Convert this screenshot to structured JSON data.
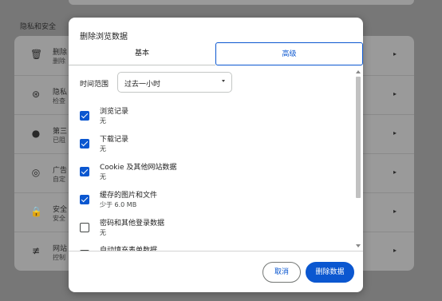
{
  "background": {
    "section_title": "隐私和安全",
    "rows": [
      {
        "icon": "trash-icon",
        "glyph": "🗑",
        "title": "删除",
        "subtitle": "删除"
      },
      {
        "icon": "safety-check-icon",
        "glyph": "⊛",
        "title": "隐私",
        "subtitle": "检查"
      },
      {
        "icon": "cookie-icon",
        "glyph": "●",
        "title": "第三",
        "subtitle": "已阻"
      },
      {
        "icon": "ads-icon",
        "glyph": "◎",
        "title": "广告",
        "subtitle": "自定"
      },
      {
        "icon": "lock-icon",
        "glyph": "🔒",
        "title": "安全",
        "subtitle": "安全"
      },
      {
        "icon": "tune-icon",
        "glyph": "≢",
        "title": "网站",
        "subtitle": "控制"
      }
    ],
    "arrow_glyph": "▸"
  },
  "dialog": {
    "title": "删除浏览数据",
    "tabs": [
      {
        "label": "基本",
        "selected": false
      },
      {
        "label": "高级",
        "selected": true
      }
    ],
    "time_range": {
      "label": "时间范围",
      "value": "过去一小时"
    },
    "items": [
      {
        "label": "浏览记录",
        "detail": "无",
        "checked": true
      },
      {
        "label": "下载记录",
        "detail": "无",
        "checked": true
      },
      {
        "label": "Cookie 及其他网站数据",
        "detail": "无",
        "checked": true
      },
      {
        "label": "缓存的图片和文件",
        "detail": "少于 6.0 MB",
        "checked": true
      },
      {
        "label": "密码和其他登录数据",
        "detail": "无",
        "checked": false
      },
      {
        "label": "自动填充表单数据",
        "detail": "",
        "checked": false
      }
    ],
    "cancel_label": "取消",
    "confirm_label": "删除数据"
  },
  "colors": {
    "accent": "#0b57d0",
    "scrim": "#777777"
  }
}
